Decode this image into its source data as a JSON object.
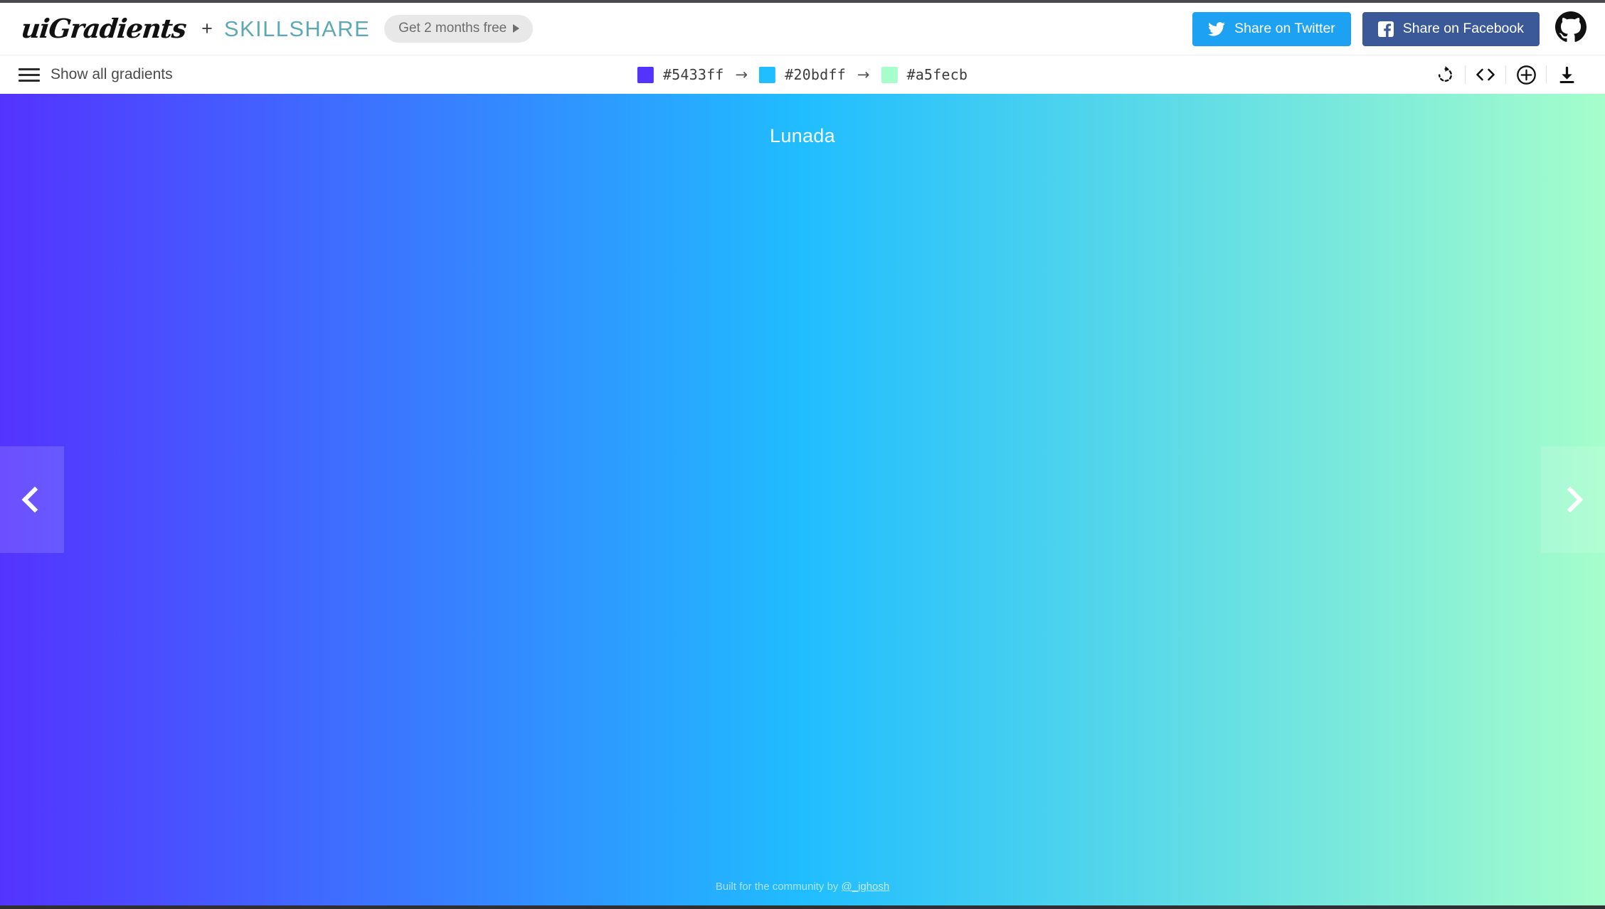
{
  "header": {
    "logo_text": "uiGradients",
    "plus": "+",
    "partner_text": "SKILLSHARE",
    "promo_label": "Get 2 months free",
    "promo_arrow_icon": "triangle-right-icon",
    "twitter_label": "Share on Twitter",
    "twitter_icon": "twitter-bird-icon",
    "twitter_color": "#1da1f2",
    "facebook_label": "Share on Facebook",
    "facebook_icon": "facebook-f-icon",
    "facebook_color": "#3b5998",
    "github_icon": "github-octocat-icon"
  },
  "toolbar": {
    "menu_icon": "hamburger-menu-icon",
    "show_all_label": "Show all gradients",
    "arrow_separator": "→",
    "colors": [
      {
        "hex": "#5433ff",
        "label": "#5433ff"
      },
      {
        "hex": "#20bdff",
        "label": "#20bdff"
      },
      {
        "hex": "#a5fecb",
        "label": "#a5fecb"
      }
    ],
    "actions": [
      {
        "name": "rotate-gradient-icon"
      },
      {
        "name": "code-brackets-icon"
      },
      {
        "name": "plus-circle-icon"
      },
      {
        "name": "download-icon"
      }
    ]
  },
  "canvas": {
    "gradient_name": "Lunada",
    "gradient_angle": "to right",
    "prev_icon": "chevron-left-icon",
    "next_icon": "chevron-right-icon"
  },
  "footer": {
    "credit_prefix": "Built for the community by ",
    "credit_handle": "@_ighosh"
  }
}
